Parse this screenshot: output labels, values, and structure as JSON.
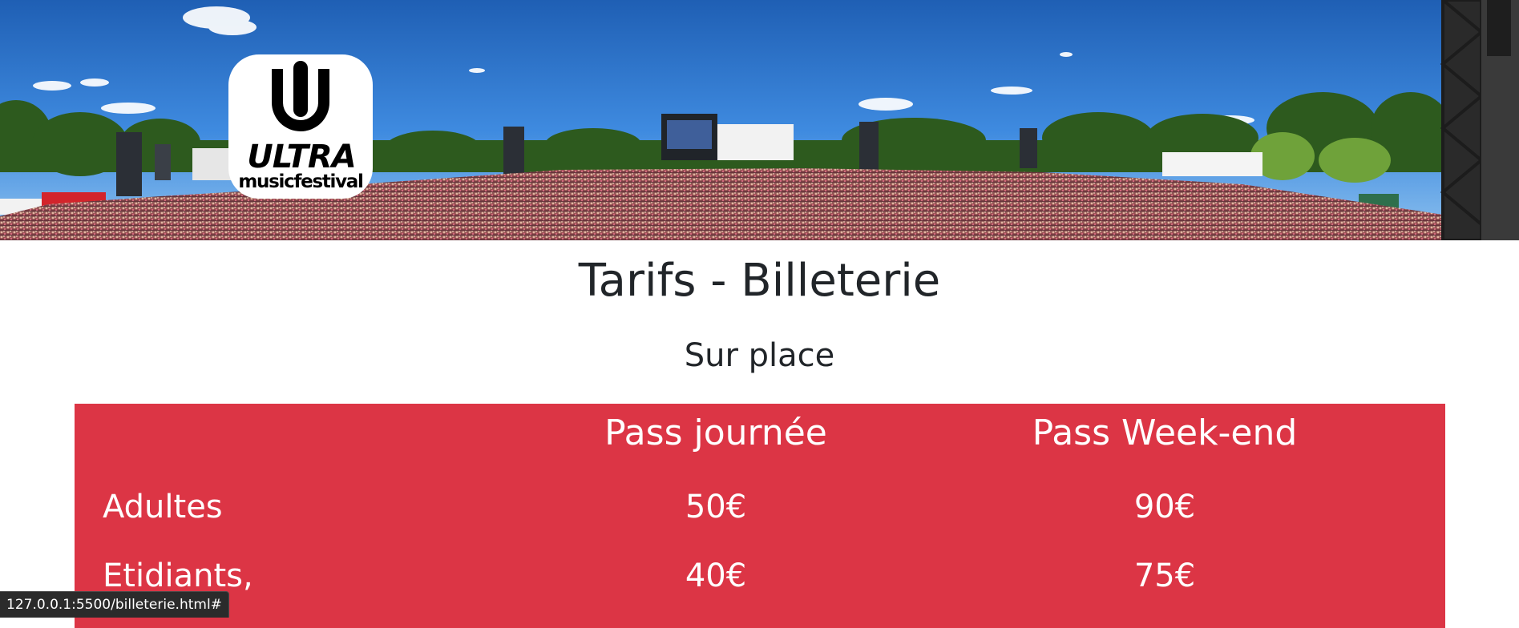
{
  "banner": {
    "logo_wordmark": "ULTRA",
    "logo_subtitle": "musicfestival"
  },
  "page": {
    "title": "Tarifs - Billeterie",
    "section_title": "Sur place"
  },
  "pricing_table": {
    "headers": [
      "",
      "Pass journée",
      "Pass Week-end"
    ],
    "rows": [
      {
        "label": "Adultes",
        "day_pass": "50€",
        "weekend_pass": "90€"
      },
      {
        "label": "Etidiants,",
        "day_pass": "40€",
        "weekend_pass": "75€"
      }
    ],
    "background_color": "#dc3545"
  },
  "status_bar": {
    "url": "127.0.0.1:5500/billeterie.html#"
  }
}
